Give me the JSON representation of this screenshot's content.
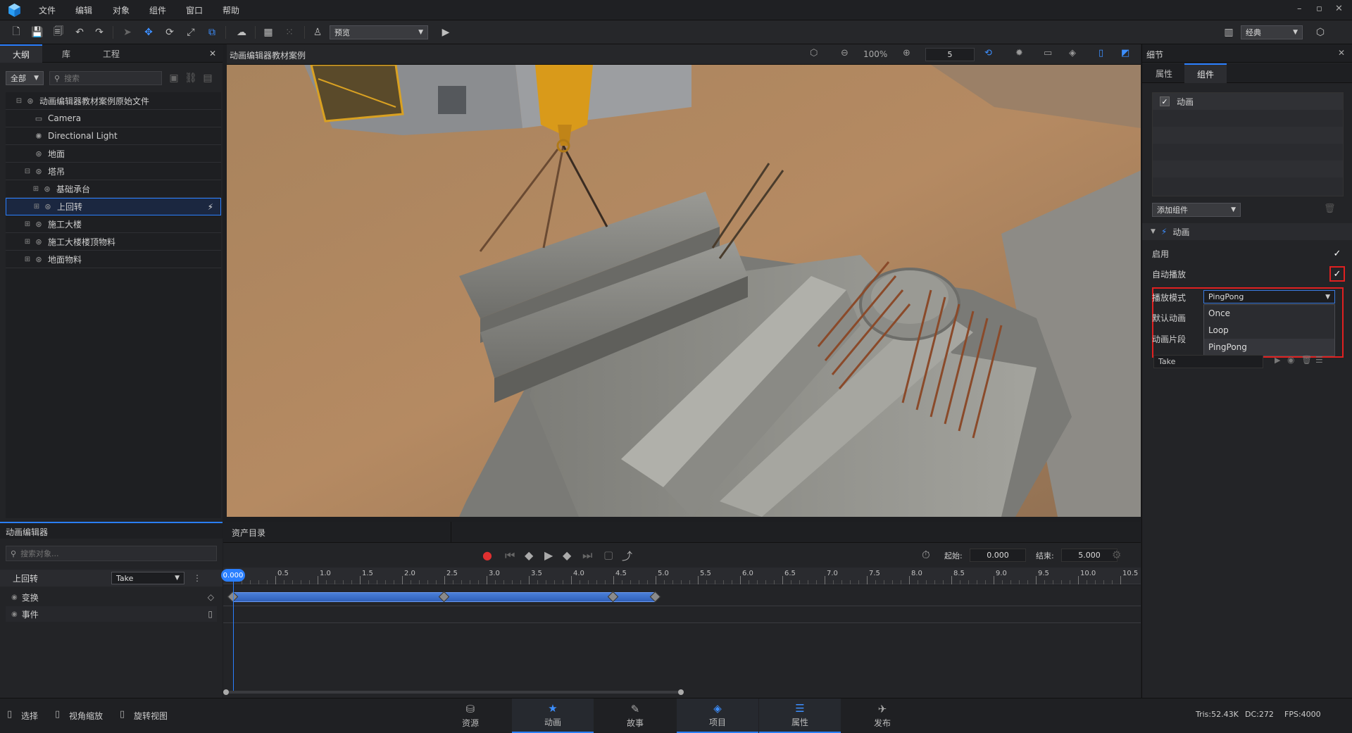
{
  "menubar": {
    "items": [
      "文件",
      "编辑",
      "对象",
      "组件",
      "窗口",
      "帮助"
    ],
    "window_buttons": [
      "–",
      "▫",
      "✕"
    ]
  },
  "toolbar": {
    "mode_select": "预览",
    "layout_select": "经典"
  },
  "left_panel": {
    "tabs": [
      "大纲",
      "库",
      "工程"
    ],
    "filter_select": "全部",
    "search_placeholder": "搜索",
    "tree": [
      {
        "label": "动画编辑器教材案例原始文件",
        "indent": 0,
        "toggle": "⊟",
        "icon": "group-icon"
      },
      {
        "label": "Camera",
        "indent": 1,
        "toggle": "",
        "icon": "camera-icon"
      },
      {
        "label": "Directional Light",
        "indent": 1,
        "toggle": "",
        "icon": "light-icon"
      },
      {
        "label": "地面",
        "indent": 1,
        "toggle": "",
        "icon": "object-icon"
      },
      {
        "label": "塔吊",
        "indent": 1,
        "toggle": "⊟",
        "icon": "object-icon"
      },
      {
        "label": "基础承台",
        "indent": 2,
        "toggle": "⊞",
        "icon": "object-icon"
      },
      {
        "label": "上回转",
        "indent": 2,
        "toggle": "⊞",
        "icon": "object-icon",
        "selected": true
      },
      {
        "label": "施工大楼",
        "indent": 1,
        "toggle": "⊞",
        "icon": "object-icon"
      },
      {
        "label": "施工大楼楼顶物料",
        "indent": 1,
        "toggle": "⊞",
        "icon": "object-icon"
      },
      {
        "label": "地面物料",
        "indent": 1,
        "toggle": "⊞",
        "icon": "object-icon"
      }
    ]
  },
  "viewport": {
    "title": "动画编辑器教材案例",
    "zoom": "100%",
    "speed": "5"
  },
  "details": {
    "title": "细节",
    "tabs": [
      "属性",
      "组件"
    ],
    "component_list": [
      {
        "label": "动画",
        "checked": true
      }
    ],
    "add_component": "添加组件",
    "section_title": "动画",
    "enabled_label": "启用",
    "autoplay_label": "自动播放",
    "play_mode_label": "播放模式",
    "play_mode_value": "PingPong",
    "default_anim_label": "默认动画",
    "clip_label": "动画片段",
    "clip_value": "Take",
    "play_mode_options": [
      "Once",
      "Loop",
      "PingPong"
    ],
    "highlight_color": "#e02020"
  },
  "anim_editor": {
    "title": "动画编辑器",
    "search_placeholder": "搜索对象...",
    "object": "上回转",
    "clip_select": "Take",
    "tracks": [
      "变换",
      "事件"
    ]
  },
  "timeline": {
    "tab": "资产目录",
    "start_label": "起始:",
    "start_value": "0.000",
    "end_label": "结束:",
    "end_value": "5.000",
    "current_time": "0.000",
    "ticks": [
      "0.5",
      "1.0",
      "1.5",
      "2.0",
      "2.5",
      "3.0",
      "3.5",
      "4.0",
      "4.5",
      "5.0",
      "5.5",
      "6.0",
      "6.5",
      "7.0",
      "7.5",
      "8.0",
      "8.5",
      "9.0",
      "9.5",
      "10.0",
      "10.5"
    ],
    "keyframes": [
      0,
      2.5,
      4.5,
      5.0
    ],
    "clip_end": 5.0
  },
  "statusbar": {
    "tools": [
      "选择",
      "视角缩放",
      "旋转视图"
    ],
    "tabs": [
      {
        "label": "资源",
        "icon": "resource-icon",
        "active": false
      },
      {
        "label": "动画",
        "icon": "animation-icon",
        "active": true
      },
      {
        "label": "故事",
        "icon": "story-icon",
        "active": false
      },
      {
        "label": "项目",
        "icon": "project-icon",
        "active": true
      },
      {
        "label": "属性",
        "icon": "property-icon",
        "active": true
      },
      {
        "label": "发布",
        "icon": "publish-icon",
        "active": false
      }
    ],
    "tris": "Tris:52.43K",
    "dc": "DC:272",
    "fps": "FPS:4000"
  }
}
